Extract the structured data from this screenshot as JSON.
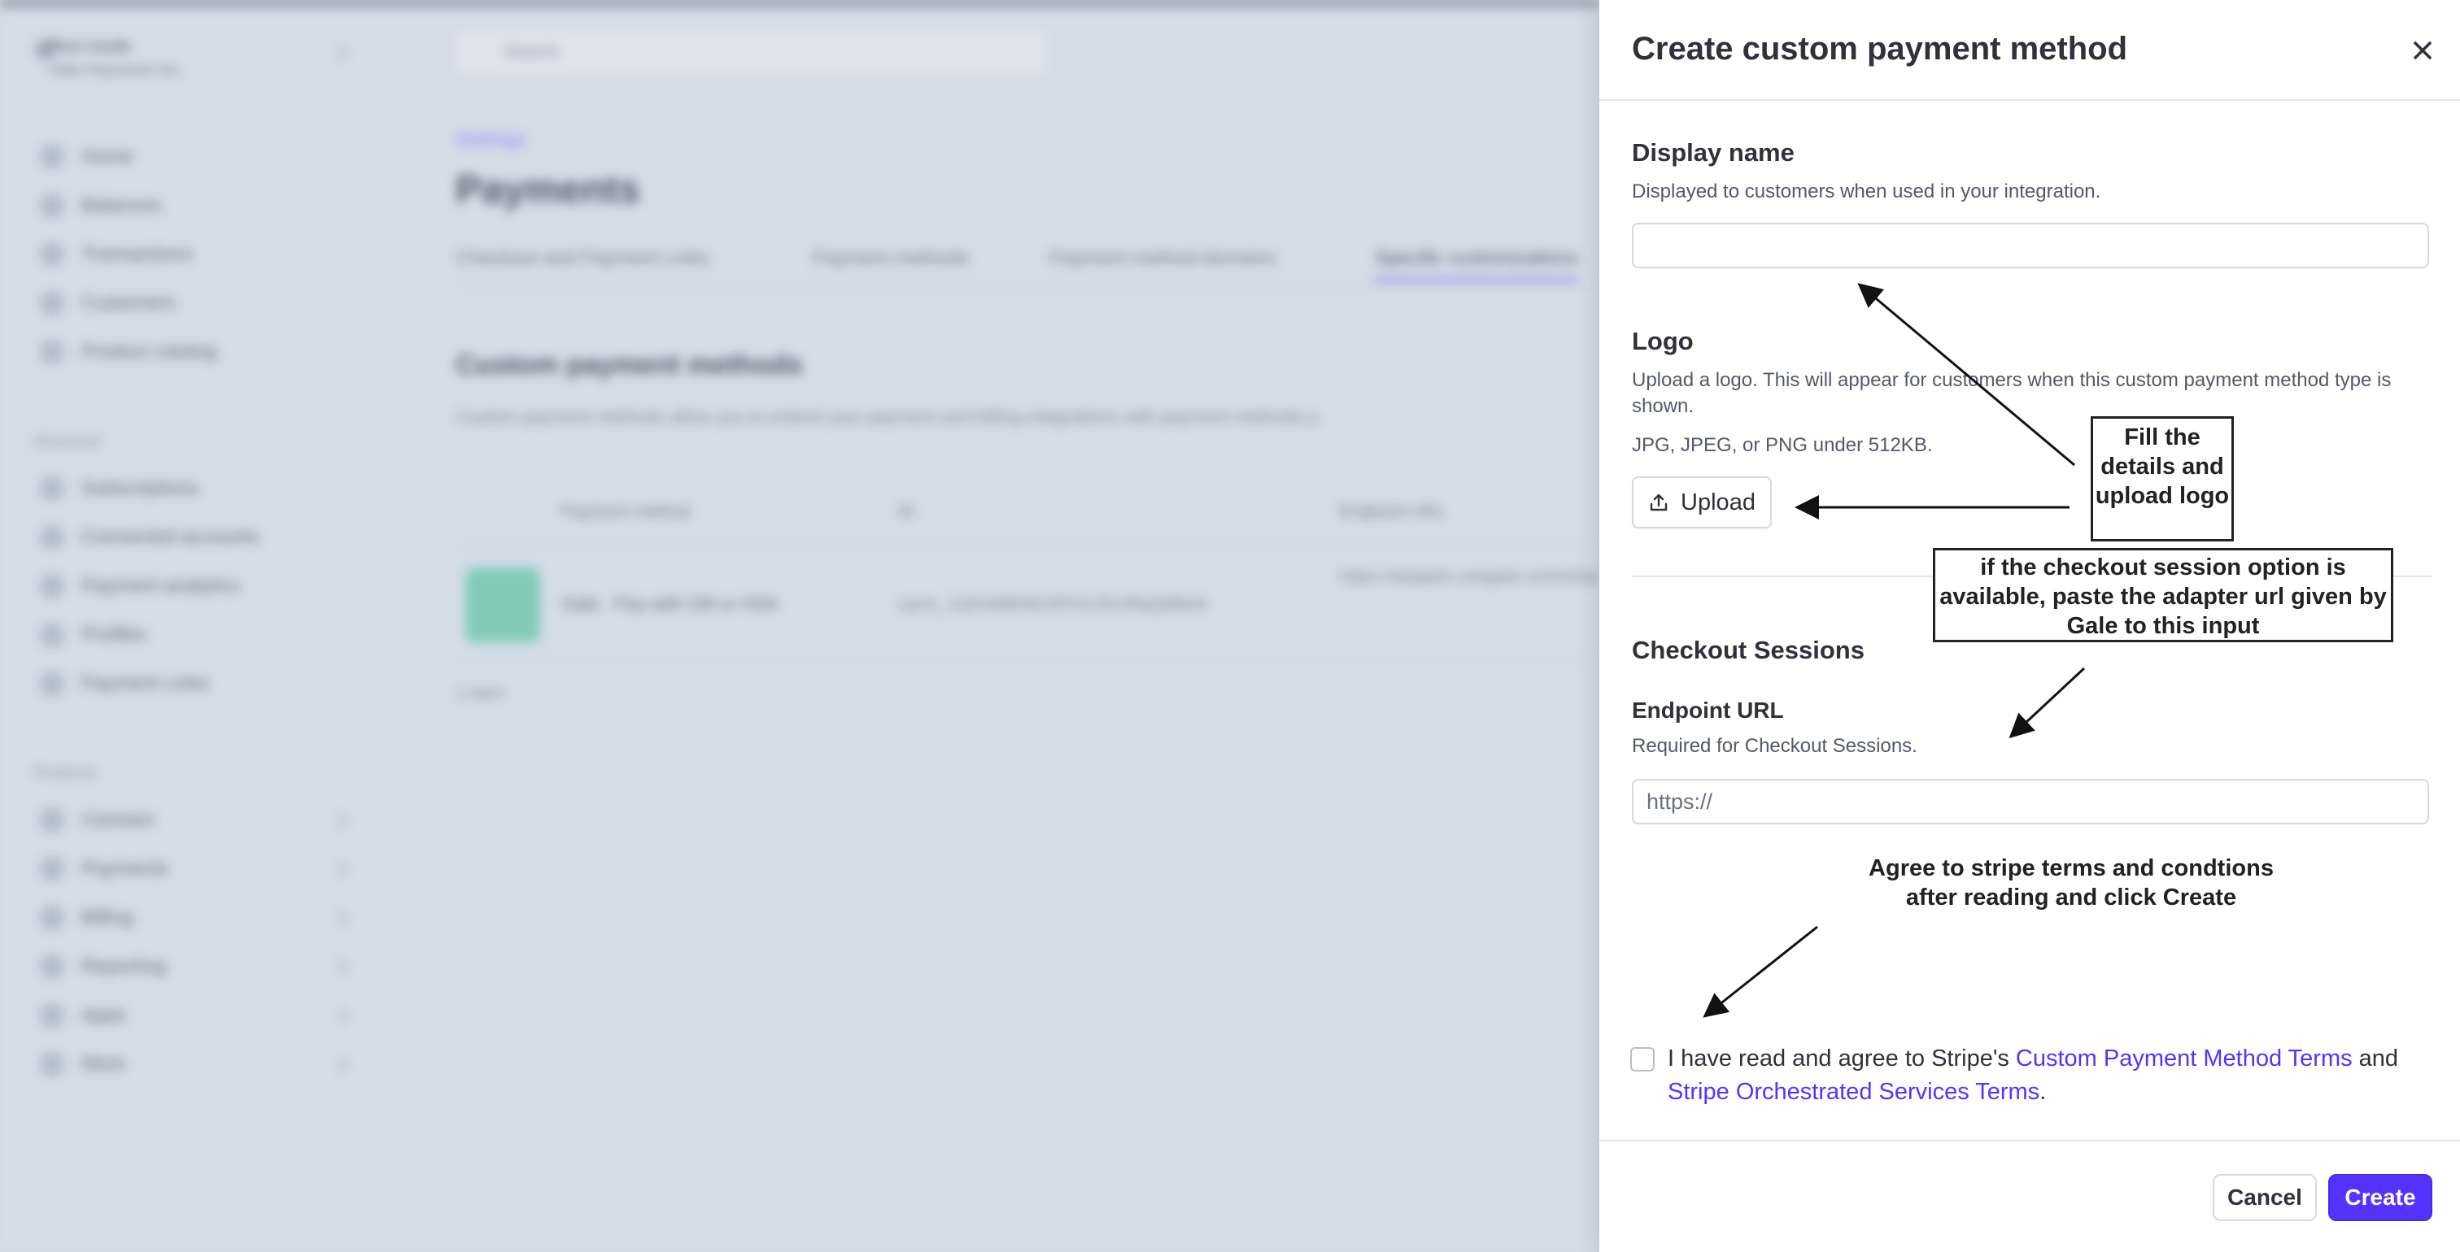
{
  "background": {
    "account": {
      "name": "Test mode",
      "sub": "Gale Payments Inc."
    },
    "search_placeholder": "Search",
    "nav": [
      {
        "label": "Home"
      },
      {
        "label": "Balances"
      },
      {
        "label": "Transactions"
      },
      {
        "label": "Customers"
      },
      {
        "label": "Product catalog"
      }
    ],
    "shortcuts_heading": "Shortcuts",
    "shortcuts": [
      {
        "label": "Subscriptions"
      },
      {
        "label": "Connected accounts"
      },
      {
        "label": "Payment analytics"
      },
      {
        "label": "Profiles"
      },
      {
        "label": "Payment Links"
      }
    ],
    "products_heading": "Products",
    "products": [
      {
        "label": "Connect"
      },
      {
        "label": "Payments"
      },
      {
        "label": "Billing"
      },
      {
        "label": "Reporting"
      },
      {
        "label": "Apps"
      },
      {
        "label": "More"
      }
    ],
    "breadcrumb": "Settings",
    "page_title": "Payments",
    "tabs": [
      {
        "label": "Checkout and Payment Links"
      },
      {
        "label": "Payment methods"
      },
      {
        "label": "Payment method domains"
      },
      {
        "label": "Specific customizations"
      }
    ],
    "section_title": "Custom payment methods",
    "section_desc": "Custom payment methods allow you to extend your payment and billing integrations with payment methods p",
    "table_headers": {
      "method": "Payment method",
      "id": "ID",
      "endpoint": "Endpoint URL"
    },
    "row": {
      "method": "Gale - Pay with Gift or HSA",
      "id": "cpmt_1Q0xM8HbGIRXAJ5U0fqQkBw5",
      "endpoint": "https://adapter.usegale.com/stripe/checkout"
    },
    "count": "1 item"
  },
  "drawer": {
    "title": "Create custom payment method",
    "display_name": {
      "label": "Display name",
      "help": "Displayed to customers when used in your integration.",
      "value": ""
    },
    "logo": {
      "label": "Logo",
      "help": "Upload a logo. This will appear for customers when this custom payment method type is shown.",
      "formats": "JPG, JPEG, or PNG under 512KB.",
      "upload_label": "Upload"
    },
    "checkout": {
      "section": "Checkout Sessions",
      "label": "Endpoint URL",
      "help": "Required for Checkout Sessions.",
      "placeholder": "https://"
    },
    "agree": {
      "prefix": "I have read and agree to Stripe's ",
      "link1": "Custom Payment Method Terms",
      "middle": " and ",
      "link2": "Stripe Orchestrated Services Terms",
      "suffix": "."
    },
    "buttons": {
      "cancel": "Cancel",
      "create": "Create"
    },
    "accent_color": "#5533ff"
  },
  "annotations": {
    "fill_details": "Fill the details and upload logo",
    "checkout_note": "if the checkout session option is available, paste the adapter url given by Gale to this input",
    "agree_note": "Agree to stripe terms and condtions after reading and click Create"
  }
}
